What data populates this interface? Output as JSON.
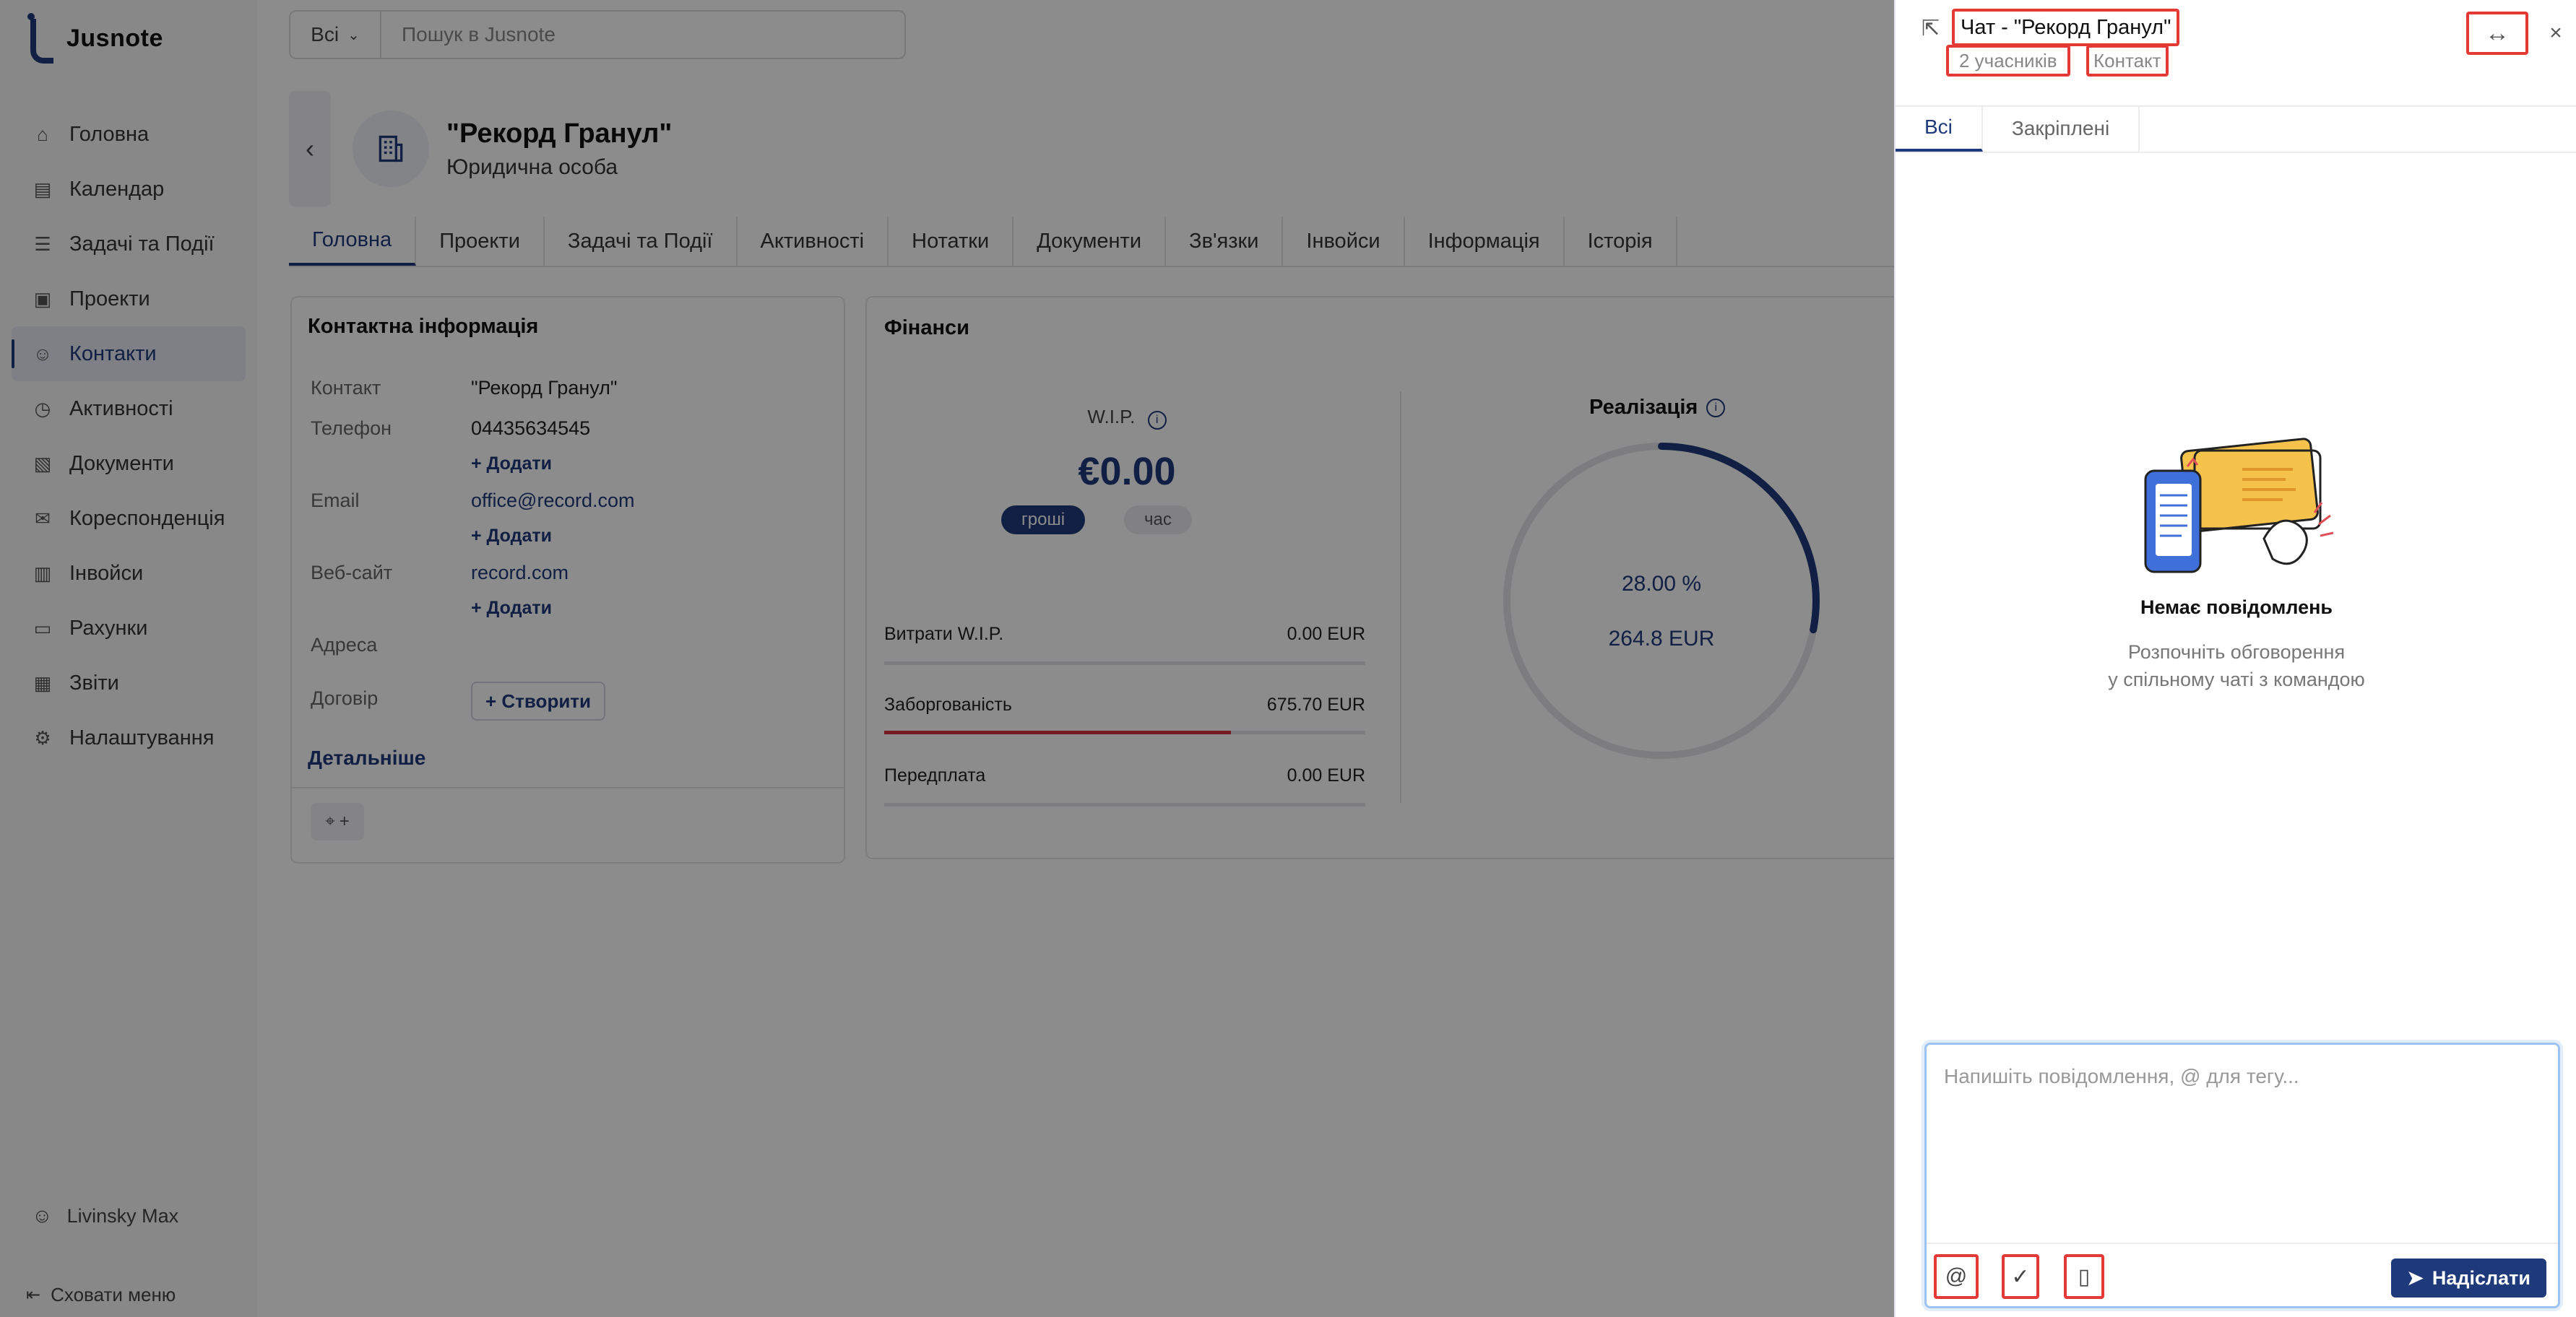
{
  "app": {
    "name": "Jusnote"
  },
  "sidebar": {
    "items": [
      {
        "label": "Головна",
        "icon": "home-icon",
        "glyph": "⌂"
      },
      {
        "label": "Календар",
        "icon": "calendar-icon",
        "glyph": "▤"
      },
      {
        "label": "Задачі та Події",
        "icon": "tasks-icon",
        "glyph": "☰"
      },
      {
        "label": "Проекти",
        "icon": "briefcase-icon",
        "glyph": "▣"
      },
      {
        "label": "Контакти",
        "icon": "contacts-icon",
        "glyph": "☺"
      },
      {
        "label": "Активності",
        "icon": "clock-icon",
        "glyph": "◷"
      },
      {
        "label": "Документи",
        "icon": "documents-icon",
        "glyph": "▧"
      },
      {
        "label": "Кореспонденція",
        "icon": "mail-icon",
        "glyph": "✉"
      },
      {
        "label": "Інвойси",
        "icon": "invoice-icon",
        "glyph": "▥"
      },
      {
        "label": "Рахунки",
        "icon": "wallet-icon",
        "glyph": "▭"
      },
      {
        "label": "Звіти",
        "icon": "reports-icon",
        "glyph": "▦"
      },
      {
        "label": "Налаштування",
        "icon": "settings-icon",
        "glyph": "⚙"
      }
    ],
    "active_index": 4,
    "user": "Livinsky Max",
    "hide_menu": "Сховати меню"
  },
  "search": {
    "scope": "Всі",
    "placeholder": "Пошук в Jusnote"
  },
  "contact": {
    "name": "\"Рекорд Гранул\"",
    "type": "Юридична особа"
  },
  "tabs": [
    "Головна",
    "Проекти",
    "Задачі та Події",
    "Активності",
    "Нотатки",
    "Документи",
    "Зв'язки",
    "Інвойси",
    "Інформація",
    "Історія"
  ],
  "contact_info": {
    "title": "Контактна інформація",
    "rows": [
      {
        "label": "Контакт",
        "value": "\"Рекорд Гранул\""
      },
      {
        "label": "Телефон",
        "value": "04435634545"
      },
      {
        "label": "Email",
        "value": "office@record.com"
      },
      {
        "label": "Веб-сайт",
        "value": "record.com"
      },
      {
        "label": "Адреса",
        "value": ""
      },
      {
        "label": "Договір",
        "value": ""
      }
    ],
    "add_label": "+ Додати",
    "create_label": "+ Створити",
    "details_label": "Детальніше",
    "tag_plus": "+"
  },
  "finance": {
    "title": "Фінанси",
    "wip_label": "W.I.P.",
    "wip_value": "€0.00",
    "toggle_money": "гроші",
    "toggle_time": "час",
    "rows": [
      {
        "label": "Витрати W.I.P.",
        "value": "0.00 EUR",
        "fill": 0
      },
      {
        "label": "Заборгованість",
        "value": "675.70 EUR",
        "fill": 0.72
      },
      {
        "label": "Передплата",
        "value": "0.00 EUR",
        "fill": 0
      }
    ],
    "realization_title": "Реалізація",
    "realization_percent": "28.00 %",
    "realization_amount": "264.8 EUR",
    "realization_fraction": 0.28
  },
  "chat": {
    "title": "Чат - \"Рекорд Гранул\"",
    "members": "2 учасників",
    "contact_link": "Контакт",
    "tabs": [
      "Всі",
      "Закріплені"
    ],
    "empty_title": "Немає повідомлень",
    "empty_line1": "Розпочніть обговорення",
    "empty_line2": "у спільному чаті з командою",
    "input_placeholder": "Напишіть повідомлення, @ для тегу...",
    "send_label": "Надіслати"
  },
  "colors": {
    "brand": "#1e3a7b",
    "danger": "#d63340",
    "highlight": "#e53935"
  }
}
